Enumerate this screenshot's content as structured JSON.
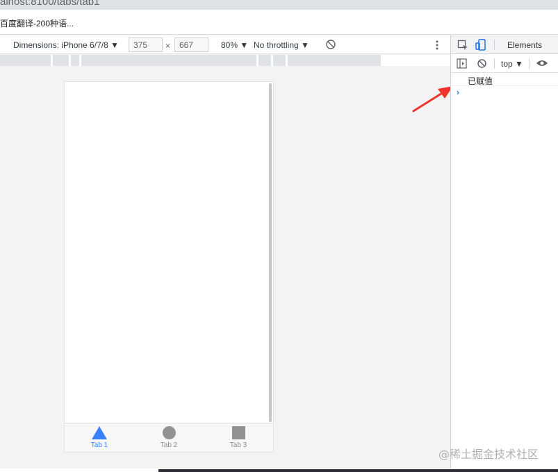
{
  "browser": {
    "url": "alhost:8100/tabs/tab1",
    "bookmark": "百度翻译-200种语..."
  },
  "device_toolbar": {
    "dimensions_label": "Dimensions: iPhone 6/7/8 ▼",
    "width_value": "375",
    "times": "×",
    "height_value": "667",
    "zoom": "80% ▼",
    "throttling": "No throttling ▼",
    "icons": [
      "rotate-icon",
      "more-options-icon"
    ]
  },
  "app": {
    "tabs": [
      {
        "label": "Tab 1",
        "icon": "triangle-icon",
        "active": true
      },
      {
        "label": "Tab 2",
        "icon": "ellipse-icon",
        "active": false
      },
      {
        "label": "Tab 3",
        "icon": "square-icon",
        "active": false
      }
    ],
    "colors": {
      "active": "#3880ff",
      "inactive": "#929292"
    }
  },
  "devtools": {
    "tab_elements": "Elements",
    "context": "top ▼",
    "console_message": "已赋值",
    "prompt": "›"
  },
  "watermark": "@稀土掘金技术社区"
}
